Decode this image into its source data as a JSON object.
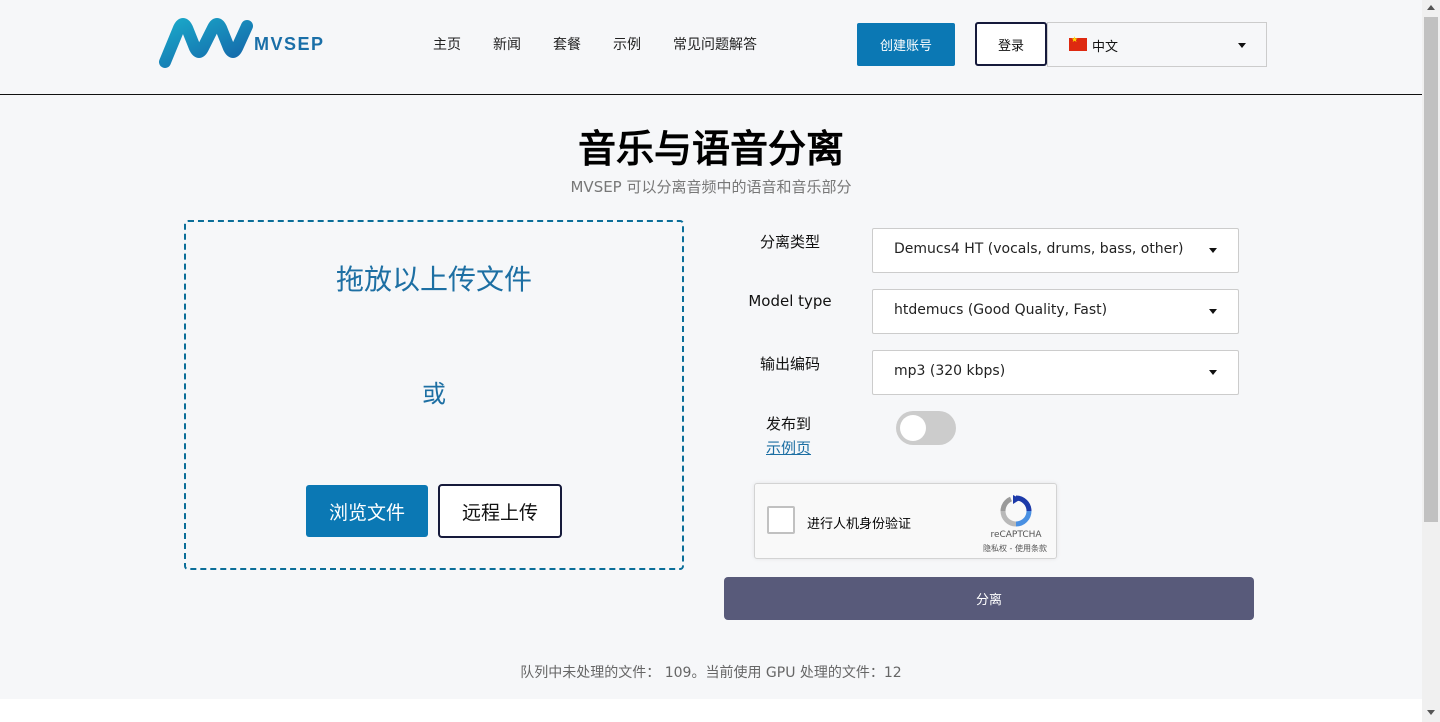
{
  "header": {
    "logo_text": "MVSEP",
    "nav": [
      "主页",
      "新闻",
      "套餐",
      "示例",
      "常见问题解答"
    ],
    "create_account": "创建账号",
    "login": "登录",
    "language": "中文"
  },
  "main": {
    "title": "音乐与语音分离",
    "subtitle": "MVSEP 可以分离音频中的语音和音乐部分"
  },
  "dropzone": {
    "title": "拖放以上传文件",
    "or": "或",
    "browse": "浏览文件",
    "remote": "远程上传"
  },
  "form": {
    "separation_type_label": "分离类型",
    "separation_type_value": "Demucs4 HT (vocals, drums, bass, other)",
    "model_type_label": "Model type",
    "model_type_value": "htdemucs (Good Quality, Fast)",
    "output_encoding_label": "输出编码",
    "output_encoding_value": "mp3 (320 kbps)",
    "publish_label": "发布到",
    "publish_link": "示例页",
    "publish_enabled": false
  },
  "recaptcha": {
    "label": "进行人机身份验证",
    "brand": "reCAPTCHA",
    "terms": "隐私权 - 使用条款"
  },
  "submit_label": "分离",
  "queue_text": "队列中未处理的文件： 109。当前使用 GPU 处理的文件：12",
  "colors": {
    "primary": "#0b78b4",
    "submit": "#585a7a",
    "link": "#1d6fa3"
  }
}
